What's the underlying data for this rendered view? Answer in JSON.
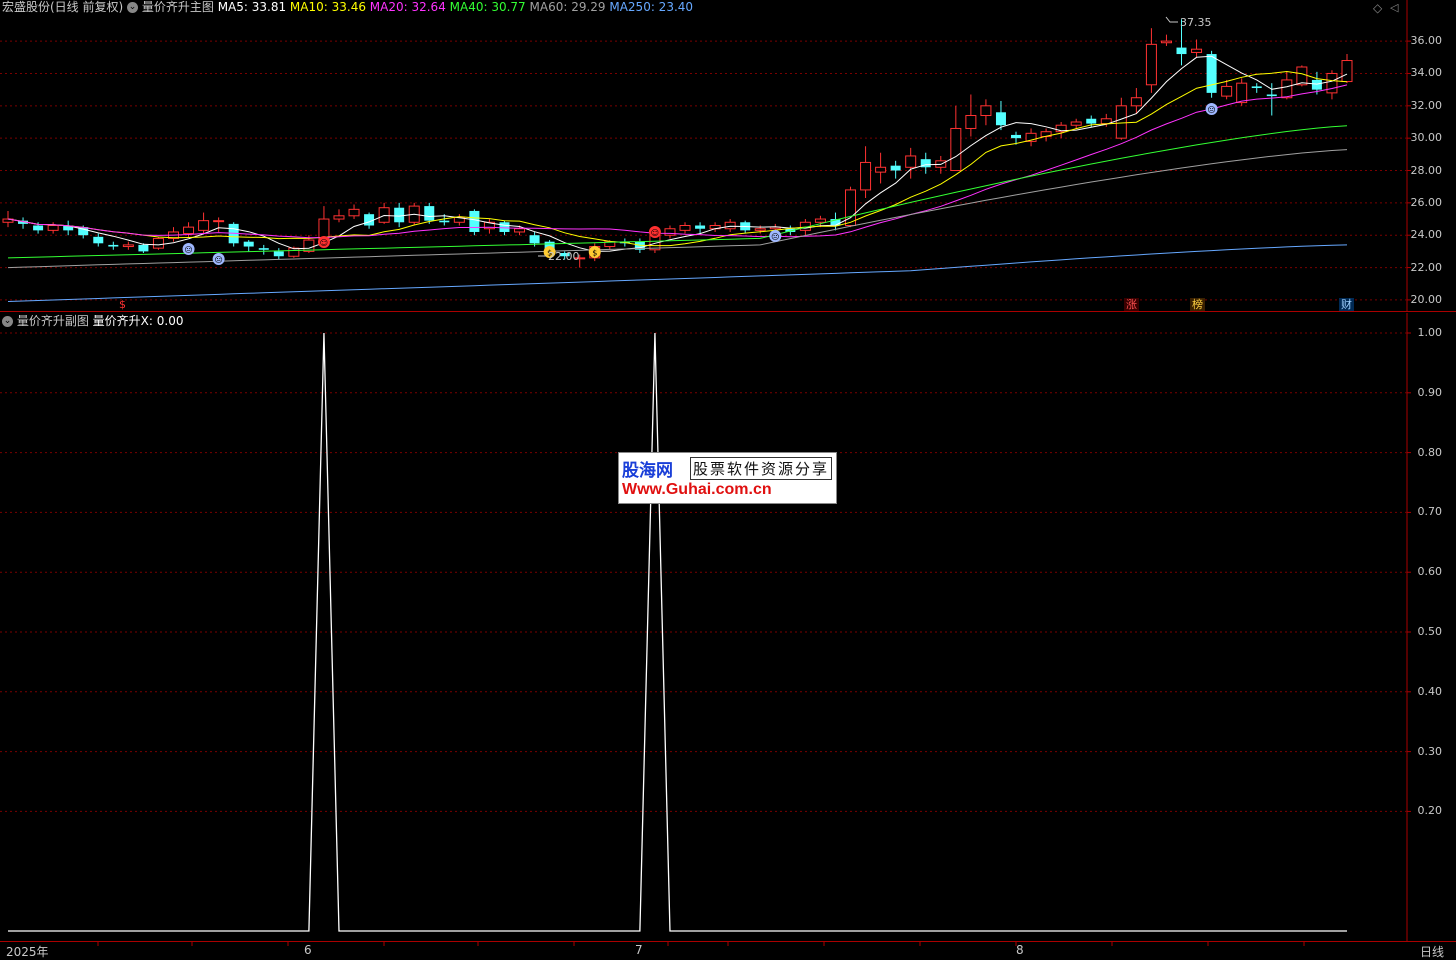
{
  "main_header": {
    "stock": "宏盛股份(日线 前复权)",
    "indicator": "量价齐升主图",
    "ma": [
      {
        "label": "MA5: 33.81",
        "color": "#ffffff"
      },
      {
        "label": "MA10: 33.46",
        "color": "#ffff00"
      },
      {
        "label": "MA20: 32.64",
        "color": "#ff33ff"
      },
      {
        "label": "MA40: 30.77",
        "color": "#33ff33"
      },
      {
        "label": "MA60: 29.29",
        "color": "#a0a0a0"
      },
      {
        "label": "MA250: 23.40",
        "color": "#66a8ff"
      }
    ]
  },
  "sub_header": {
    "indicator": "量价齐升副图",
    "value": "量价齐升X: 0.00"
  },
  "price_axis": [
    "36.00",
    "34.00",
    "32.00",
    "30.00",
    "28.00",
    "26.00",
    "24.00",
    "22.00",
    "20.00"
  ],
  "sub_axis": [
    "1.00",
    "0.90",
    "0.80",
    "0.70",
    "0.60",
    "0.50",
    "0.40",
    "0.30",
    "0.20"
  ],
  "annotations": {
    "high": "37.35",
    "low": "22.00"
  },
  "badges": {
    "zhang": "涨",
    "bang": "榜",
    "cai": "财",
    "dollar": "$"
  },
  "date_axis": {
    "year": "2025年",
    "m6": "6",
    "m7": "7",
    "m8": "8",
    "period": "日线"
  },
  "watermark": {
    "brand": "股海网",
    "slogan": "股票软件资源分享",
    "url": "Www.Guhai.com.cn"
  },
  "colors": {
    "up": "#ff3232",
    "down": "#54ffff",
    "grid": "#7a0000",
    "axis": "#aa0000"
  },
  "chart_data": {
    "type": "candlestick",
    "candles": [
      [
        24.8,
        25.0,
        24.5,
        25.5
      ],
      [
        24.9,
        24.7,
        24.4,
        25.1
      ],
      [
        24.6,
        24.3,
        24.1,
        24.8
      ],
      [
        24.3,
        24.6,
        24.1,
        24.8
      ],
      [
        24.6,
        24.3,
        24.0,
        24.9
      ],
      [
        24.5,
        24.0,
        23.8,
        24.6
      ],
      [
        23.9,
        23.5,
        23.3,
        24.1
      ],
      [
        23.4,
        23.3,
        23.1,
        23.6
      ],
      [
        23.3,
        23.4,
        23.1,
        23.6
      ],
      [
        23.4,
        23.0,
        22.9,
        23.5
      ],
      [
        23.2,
        23.8,
        23.1,
        23.9
      ],
      [
        23.8,
        24.2,
        23.6,
        24.5
      ],
      [
        24.1,
        24.5,
        23.9,
        24.8
      ],
      [
        24.3,
        24.9,
        24.1,
        25.4
      ],
      [
        24.9,
        24.9,
        24.2,
        25.1
      ],
      [
        24.7,
        23.5,
        23.3,
        24.8
      ],
      [
        23.6,
        23.3,
        23.0,
        23.7
      ],
      [
        23.2,
        23.1,
        22.8,
        23.4
      ],
      [
        23.0,
        22.7,
        22.5,
        23.2
      ],
      [
        22.7,
        23.2,
        22.6,
        23.3
      ],
      [
        23.0,
        23.7,
        22.9,
        24.0
      ],
      [
        23.5,
        25.0,
        23.5,
        25.8
      ],
      [
        25.0,
        25.2,
        24.8,
        25.6
      ],
      [
        25.2,
        25.6,
        25.0,
        25.9
      ],
      [
        25.3,
        24.6,
        24.4,
        25.4
      ],
      [
        24.8,
        25.7,
        24.7,
        26.0
      ],
      [
        25.7,
        24.8,
        24.5,
        26.0
      ],
      [
        24.8,
        25.8,
        24.6,
        26.0
      ],
      [
        25.8,
        24.9,
        24.7,
        26.0
      ],
      [
        24.9,
        24.8,
        24.6,
        25.3
      ],
      [
        24.8,
        25.1,
        24.6,
        25.3
      ],
      [
        25.5,
        24.2,
        24.0,
        25.6
      ],
      [
        24.4,
        24.8,
        24.1,
        25.0
      ],
      [
        24.8,
        24.2,
        24.0,
        24.9
      ],
      [
        24.2,
        24.4,
        24.0,
        24.6
      ],
      [
        24.0,
        23.5,
        23.3,
        24.2
      ],
      [
        23.6,
        22.9,
        22.7,
        23.7
      ],
      [
        22.9,
        22.7,
        22.5,
        23.0
      ],
      [
        22.6,
        22.6,
        22.0,
        22.8
      ],
      [
        22.6,
        23.3,
        22.4,
        23.5
      ],
      [
        23.3,
        23.6,
        23.1,
        23.7
      ],
      [
        23.6,
        23.5,
        23.3,
        23.8
      ],
      [
        23.6,
        23.1,
        22.9,
        23.8
      ],
      [
        23.1,
        24.0,
        22.9,
        24.1
      ],
      [
        24.0,
        24.4,
        23.8,
        24.6
      ],
      [
        24.3,
        24.6,
        24.1,
        24.8
      ],
      [
        24.6,
        24.4,
        24.1,
        24.8
      ],
      [
        24.4,
        24.6,
        24.2,
        24.8
      ],
      [
        24.4,
        24.8,
        24.2,
        25.0
      ],
      [
        24.8,
        24.3,
        24.1,
        24.9
      ],
      [
        24.3,
        24.4,
        24.1,
        24.6
      ],
      [
        24.4,
        24.5,
        24.2,
        24.7
      ],
      [
        24.4,
        24.2,
        24.0,
        24.6
      ],
      [
        24.3,
        24.8,
        24.0,
        25.0
      ],
      [
        24.8,
        25.0,
        24.5,
        25.2
      ],
      [
        25.0,
        24.6,
        24.3,
        25.4
      ],
      [
        24.6,
        26.8,
        24.5,
        27.0
      ],
      [
        26.8,
        28.5,
        26.3,
        29.5
      ],
      [
        27.9,
        28.2,
        27.2,
        29.1
      ],
      [
        28.3,
        28.0,
        27.5,
        28.6
      ],
      [
        28.2,
        28.9,
        27.5,
        29.4
      ],
      [
        28.7,
        28.2,
        27.8,
        29.1
      ],
      [
        28.2,
        28.6,
        27.8,
        28.9
      ],
      [
        28.0,
        30.6,
        28.0,
        32.0
      ],
      [
        30.6,
        31.4,
        30.1,
        32.7
      ],
      [
        31.4,
        32.0,
        30.8,
        32.4
      ],
      [
        31.6,
        30.8,
        30.5,
        32.3
      ],
      [
        30.2,
        30.0,
        29.6,
        30.4
      ],
      [
        29.8,
        30.3,
        29.5,
        30.6
      ],
      [
        30.1,
        30.4,
        29.8,
        30.6
      ],
      [
        30.4,
        30.8,
        30.0,
        31.0
      ],
      [
        30.8,
        31.0,
        30.6,
        31.2
      ],
      [
        31.2,
        30.9,
        30.7,
        31.4
      ],
      [
        30.9,
        31.2,
        30.7,
        31.5
      ],
      [
        30.0,
        32.0,
        29.9,
        32.5
      ],
      [
        32.0,
        32.5,
        31.5,
        33.1
      ],
      [
        33.3,
        35.8,
        32.8,
        36.8
      ],
      [
        35.9,
        36.0,
        35.7,
        36.4
      ],
      [
        35.6,
        35.2,
        34.5,
        37.35
      ],
      [
        35.3,
        35.5,
        35.0,
        36.1
      ],
      [
        35.2,
        32.8,
        32.5,
        35.4
      ],
      [
        32.6,
        33.2,
        32.4,
        33.6
      ],
      [
        32.2,
        33.4,
        32.0,
        33.7
      ],
      [
        33.2,
        33.1,
        32.8,
        33.4
      ],
      [
        32.7,
        32.6,
        31.4,
        33.4
      ],
      [
        32.5,
        33.6,
        32.4,
        34.1
      ],
      [
        33.3,
        34.4,
        33.2,
        34.5
      ],
      [
        33.6,
        33.0,
        32.7,
        34.1
      ],
      [
        32.8,
        34.0,
        32.4,
        34.2
      ],
      [
        33.5,
        34.8,
        33.4,
        35.2
      ]
    ],
    "ma5_end": 33.81,
    "ma10_end": 33.46,
    "ma20_end": 32.64,
    "ma40_end": 30.77,
    "ma60_end": 29.29,
    "ma250_end": 23.4,
    "ylim": [
      19.5,
      37.8
    ],
    "sub_series": {
      "name": "量价齐升X",
      "ylim": [
        0,
        1.0
      ],
      "spikes_at_candle": [
        21,
        43
      ],
      "values": "0 except 1.0 at spikes"
    }
  }
}
